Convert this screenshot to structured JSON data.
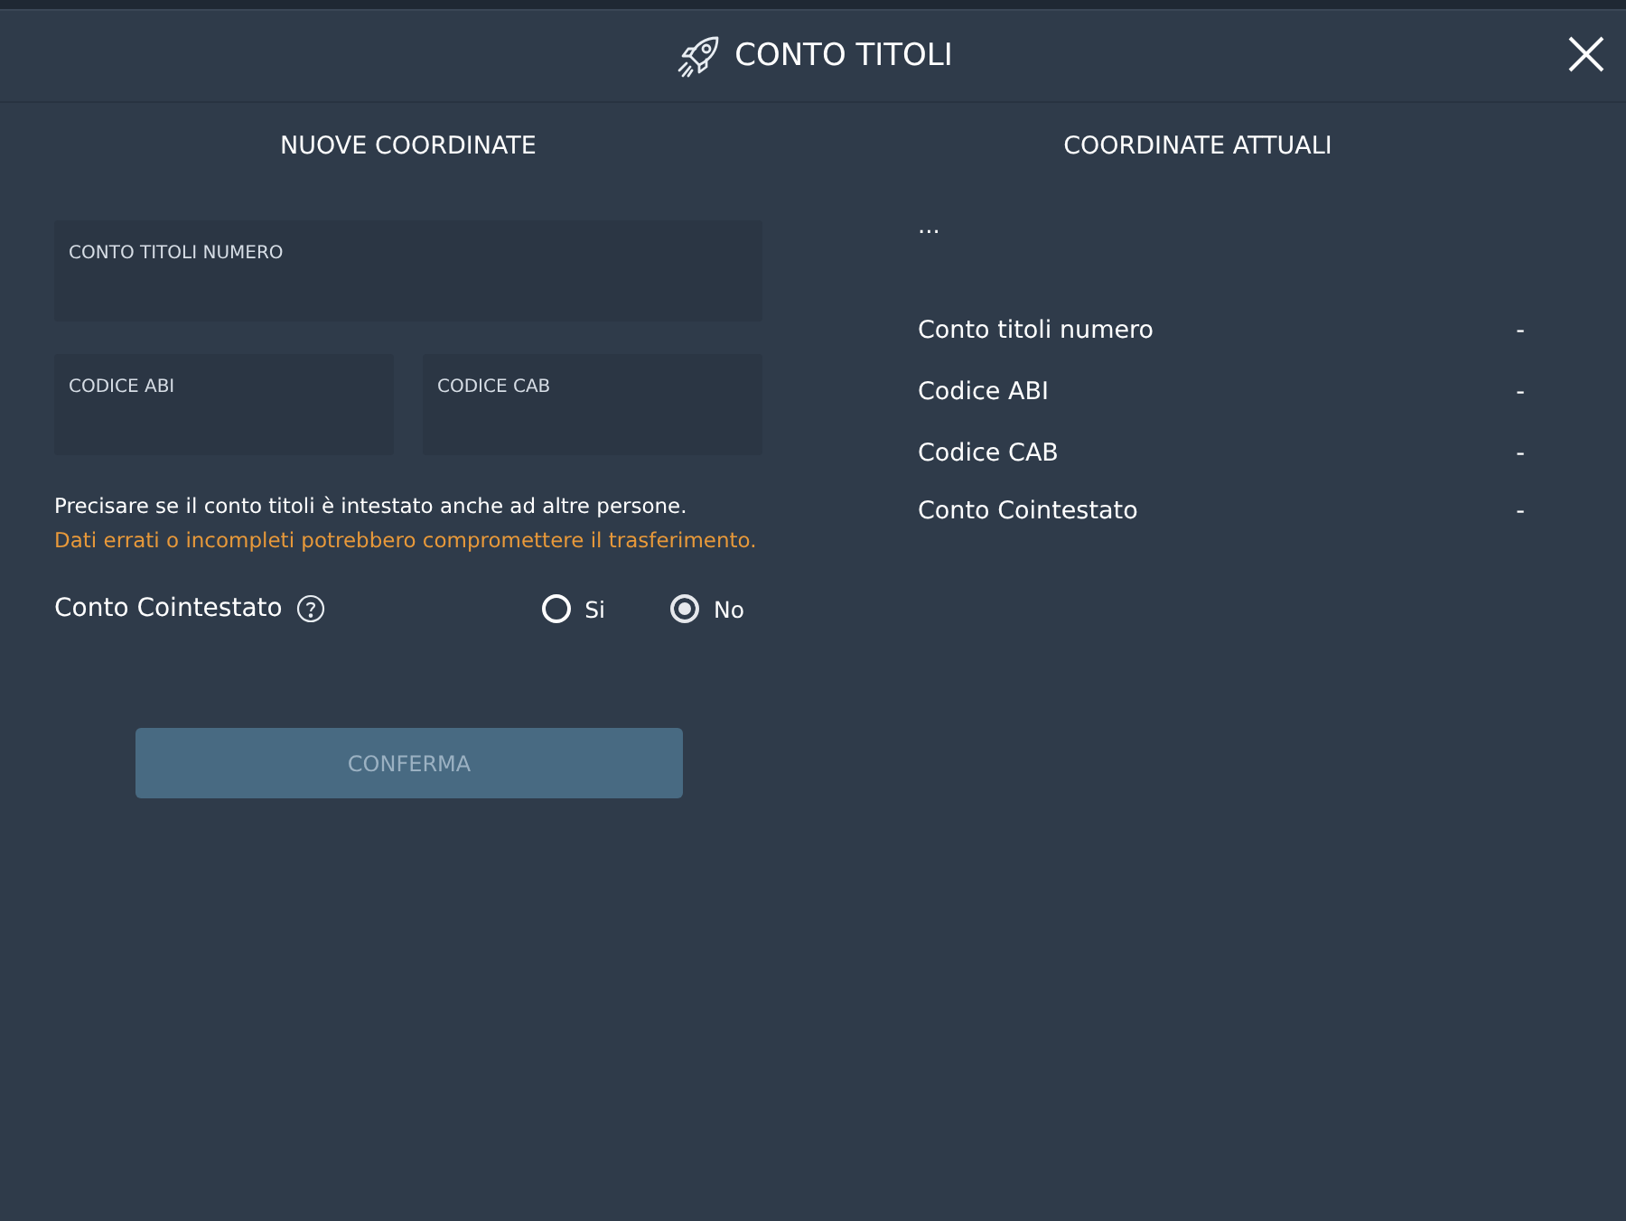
{
  "dialog": {
    "title": "CONTO TITOLI"
  },
  "new_details": {
    "heading": "NUOVE COORDINATE",
    "fields": [
      {
        "label": "CONTO TITOLI NUMERO",
        "wide": true
      },
      {
        "label": "CODICE ABI",
        "wide": false
      },
      {
        "label": "CODICE CAB",
        "wide": false
      }
    ],
    "note": "Precisare se il conto titoli è intestato anche ad altre persone.",
    "warning": "Dati errati o incompleti potrebbero compromettere il trasferimento.",
    "joint_account": {
      "label": "Conto Cointestato",
      "options": [
        {
          "label": "Si",
          "selected": false
        },
        {
          "label": "No",
          "selected": true
        }
      ]
    },
    "confirm": {
      "label": "CONFERMA",
      "disabled": true
    }
  },
  "current_details": {
    "heading": "COORDINATE ATTUALI",
    "placeholder": "...",
    "rows": [
      {
        "label": "Conto titoli numero",
        "value": "-"
      },
      {
        "label": "Codice ABI",
        "value": "-"
      },
      {
        "label": "Codice CAB",
        "value": "-"
      },
      {
        "label": "Conto Cointestato",
        "value": "-"
      }
    ]
  }
}
